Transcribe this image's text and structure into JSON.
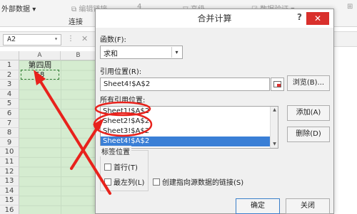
{
  "ribbon": {
    "split_data": "外部数据",
    "split_data_arrow": "▾",
    "edit_links": "编辑链接",
    "connections": "连接",
    "group_icon": "⊞",
    "validate_prefix": "4",
    "advanced": "高级",
    "data_validation": "数据验证",
    "dv_arrow": "▾",
    "ribbon_right": "⊞"
  },
  "formula_bar": {
    "name_box": "A2",
    "dropdown": "▾",
    "sep": "⋮",
    "cancel": "✕"
  },
  "sheet": {
    "columns": [
      "A",
      "B"
    ],
    "rows": [
      "1",
      "2",
      "3",
      "4",
      "5",
      "6",
      "7",
      "8",
      "9",
      "10",
      "11",
      "12",
      "13",
      "14",
      "15",
      "16"
    ],
    "a1": "第四周",
    "a2": "58"
  },
  "dialog": {
    "title": "合并计算",
    "help": "?",
    "close": "✕",
    "function_label": "函数(F):",
    "function_value": "求和",
    "function_arrow": "▾",
    "reference_label": "引用位置(R):",
    "reference_value": "Sheet4!$A$2",
    "browse_button": "浏览(B)...",
    "all_refs_label": "所有引用位置:",
    "all_refs": [
      "Sheet1!$A$2",
      "Sheet2!$A$2",
      "Sheet3!$A$2",
      "Sheet4!$A$2"
    ],
    "selected_index": 3,
    "add_button": "添加(A)",
    "delete_button": "删除(D)",
    "labels_group": "标签位置",
    "first_row": "首行(T)",
    "left_column": "最左列(L)",
    "create_links": "创建指向源数据的链接(S)",
    "ok_button": "确定",
    "close_button": "关闭",
    "scroll_up": "▲",
    "scroll_down": "▼"
  },
  "colors": {
    "annotation_red": "#e8221c",
    "selection_blue": "#3a7fd6",
    "cell_green": "#d5ecd0",
    "close_red": "#d9302c"
  }
}
